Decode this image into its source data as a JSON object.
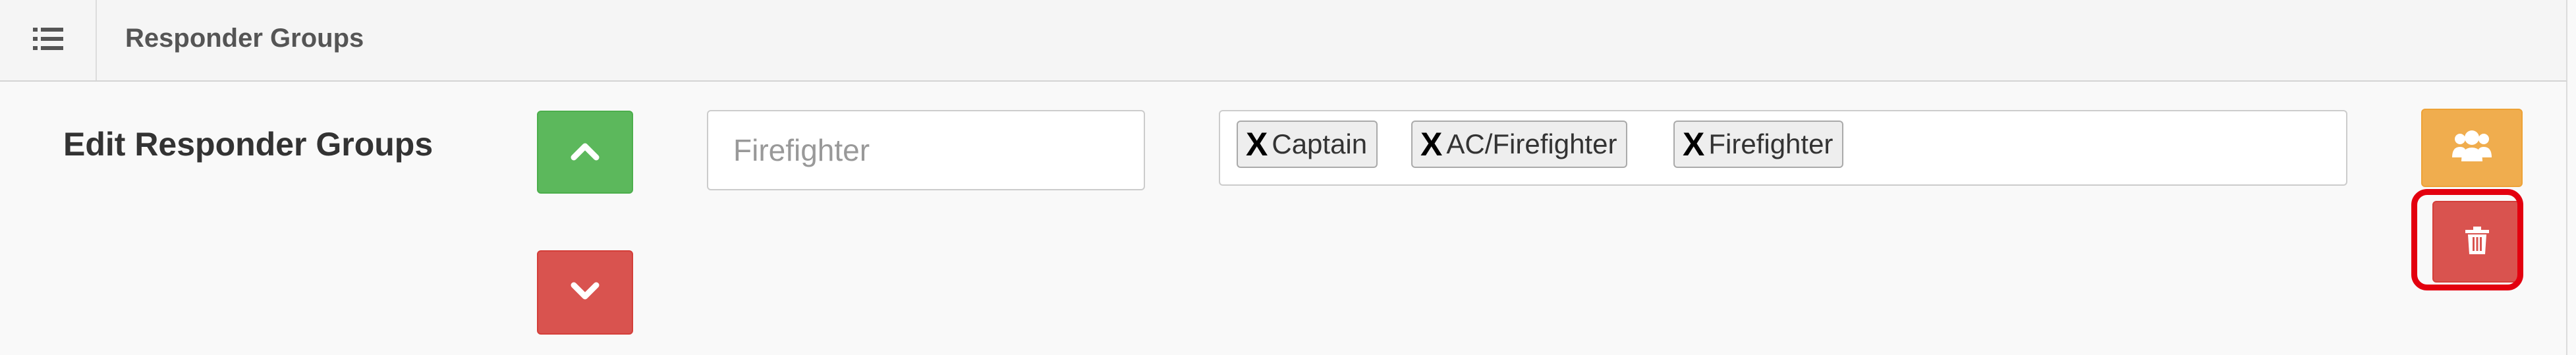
{
  "header": {
    "title": "Responder Groups",
    "menu_icon": "list-icon"
  },
  "section": {
    "label": "Edit Responder Groups"
  },
  "buttons": {
    "move_up_icon": "chevron-up-icon",
    "move_down_icon": "chevron-down-icon",
    "groups_icon": "users-icon",
    "delete_icon": "trash-icon"
  },
  "group_name_input": {
    "value": "",
    "placeholder": "Firefighter"
  },
  "tags": [
    {
      "remove": "X",
      "label": "Captain"
    },
    {
      "remove": "X",
      "label": "AC/Firefighter"
    },
    {
      "remove": "X",
      "label": "Firefighter"
    }
  ],
  "colors": {
    "success": "#5cb85c",
    "danger": "#d9534f",
    "warning": "#f0ad4e",
    "highlight": "#e3000f"
  }
}
